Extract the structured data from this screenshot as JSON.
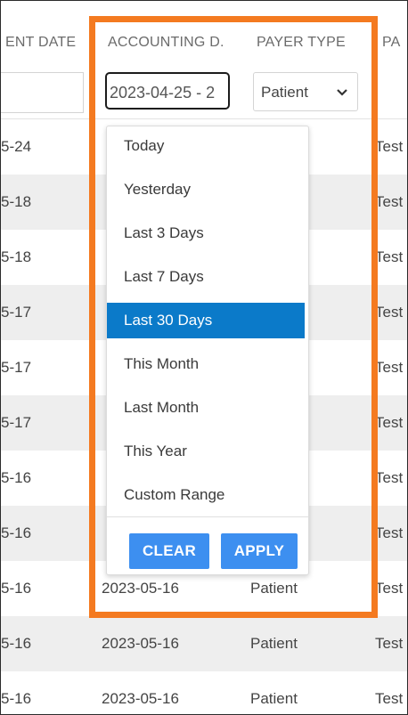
{
  "table": {
    "columns": [
      "ENT DATE",
      "ACCOUNTING D.",
      "PAYER TYPE",
      "PA"
    ],
    "filters": {
      "date_value": "2023-04-25 - 2",
      "payer_type_selected": "Patient"
    },
    "rows": [
      {
        "c1": "5-24",
        "c2": "",
        "c3": "",
        "c4": "Test"
      },
      {
        "c1": "5-18",
        "c2": "",
        "c3": "",
        "c4": "Test"
      },
      {
        "c1": "5-18",
        "c2": "",
        "c3": "",
        "c4": "Test"
      },
      {
        "c1": "5-17",
        "c2": "",
        "c3": "",
        "c4": "Test"
      },
      {
        "c1": "5-17",
        "c2": "",
        "c3": "",
        "c4": "Test"
      },
      {
        "c1": "5-17",
        "c2": "",
        "c3": "",
        "c4": "Test"
      },
      {
        "c1": "5-16",
        "c2": "",
        "c3": "",
        "c4": "Test"
      },
      {
        "c1": "5-16",
        "c2": "",
        "c3": "",
        "c4": "Test"
      },
      {
        "c1": "5-16",
        "c2": "2023-05-16",
        "c3": "Patient",
        "c4": "Test"
      },
      {
        "c1": "5-16",
        "c2": "2023-05-16",
        "c3": "Patient",
        "c4": "Test"
      },
      {
        "c1": "5-16",
        "c2": "2023-05-16",
        "c3": "Patient",
        "c4": "Test"
      }
    ]
  },
  "daterange": {
    "ranges": [
      "Today",
      "Yesterday",
      "Last 3 Days",
      "Last 7 Days",
      "Last 30 Days",
      "This Month",
      "Last Month",
      "This Year",
      "Custom Range"
    ],
    "active_range": "Last 30 Days",
    "clear_label": "CLEAR",
    "apply_label": "APPLY"
  },
  "icons": {
    "select_chevron": "chevron-down-icon"
  },
  "colors": {
    "highlight": "#f47a20",
    "active_range_bg": "#0b7ac9",
    "button_bg": "#3d8ff0",
    "row_alt_bg": "#eeeeee"
  }
}
